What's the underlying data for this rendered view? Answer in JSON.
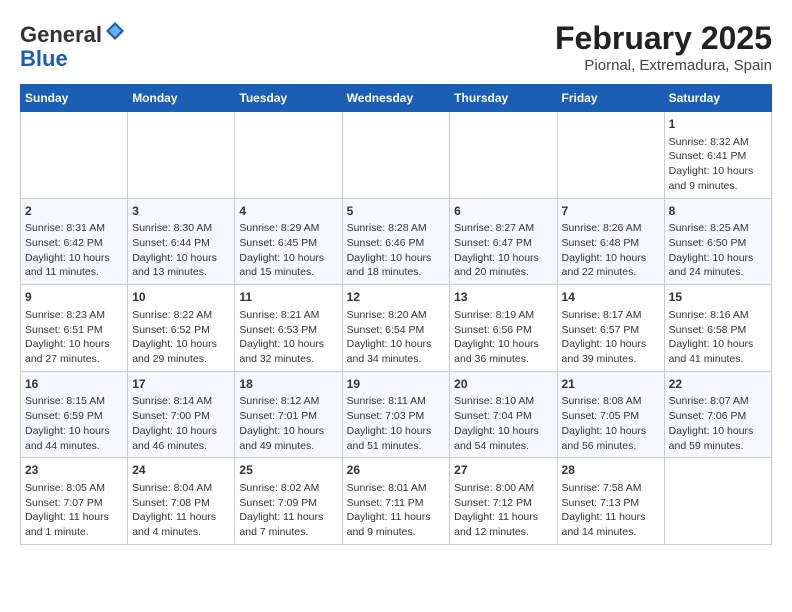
{
  "header": {
    "logo_general": "General",
    "logo_blue": "Blue",
    "month_title": "February 2025",
    "location": "Piornal, Extremadura, Spain"
  },
  "weekdays": [
    "Sunday",
    "Monday",
    "Tuesday",
    "Wednesday",
    "Thursday",
    "Friday",
    "Saturday"
  ],
  "weeks": [
    [
      {
        "day": "",
        "content": ""
      },
      {
        "day": "",
        "content": ""
      },
      {
        "day": "",
        "content": ""
      },
      {
        "day": "",
        "content": ""
      },
      {
        "day": "",
        "content": ""
      },
      {
        "day": "",
        "content": ""
      },
      {
        "day": "1",
        "content": "Sunrise: 8:32 AM\nSunset: 6:41 PM\nDaylight: 10 hours and 9 minutes."
      }
    ],
    [
      {
        "day": "2",
        "content": "Sunrise: 8:31 AM\nSunset: 6:42 PM\nDaylight: 10 hours and 11 minutes."
      },
      {
        "day": "3",
        "content": "Sunrise: 8:30 AM\nSunset: 6:44 PM\nDaylight: 10 hours and 13 minutes."
      },
      {
        "day": "4",
        "content": "Sunrise: 8:29 AM\nSunset: 6:45 PM\nDaylight: 10 hours and 15 minutes."
      },
      {
        "day": "5",
        "content": "Sunrise: 8:28 AM\nSunset: 6:46 PM\nDaylight: 10 hours and 18 minutes."
      },
      {
        "day": "6",
        "content": "Sunrise: 8:27 AM\nSunset: 6:47 PM\nDaylight: 10 hours and 20 minutes."
      },
      {
        "day": "7",
        "content": "Sunrise: 8:26 AM\nSunset: 6:48 PM\nDaylight: 10 hours and 22 minutes."
      },
      {
        "day": "8",
        "content": "Sunrise: 8:25 AM\nSunset: 6:50 PM\nDaylight: 10 hours and 24 minutes."
      }
    ],
    [
      {
        "day": "9",
        "content": "Sunrise: 8:23 AM\nSunset: 6:51 PM\nDaylight: 10 hours and 27 minutes."
      },
      {
        "day": "10",
        "content": "Sunrise: 8:22 AM\nSunset: 6:52 PM\nDaylight: 10 hours and 29 minutes."
      },
      {
        "day": "11",
        "content": "Sunrise: 8:21 AM\nSunset: 6:53 PM\nDaylight: 10 hours and 32 minutes."
      },
      {
        "day": "12",
        "content": "Sunrise: 8:20 AM\nSunset: 6:54 PM\nDaylight: 10 hours and 34 minutes."
      },
      {
        "day": "13",
        "content": "Sunrise: 8:19 AM\nSunset: 6:56 PM\nDaylight: 10 hours and 36 minutes."
      },
      {
        "day": "14",
        "content": "Sunrise: 8:17 AM\nSunset: 6:57 PM\nDaylight: 10 hours and 39 minutes."
      },
      {
        "day": "15",
        "content": "Sunrise: 8:16 AM\nSunset: 6:58 PM\nDaylight: 10 hours and 41 minutes."
      }
    ],
    [
      {
        "day": "16",
        "content": "Sunrise: 8:15 AM\nSunset: 6:59 PM\nDaylight: 10 hours and 44 minutes."
      },
      {
        "day": "17",
        "content": "Sunrise: 8:14 AM\nSunset: 7:00 PM\nDaylight: 10 hours and 46 minutes."
      },
      {
        "day": "18",
        "content": "Sunrise: 8:12 AM\nSunset: 7:01 PM\nDaylight: 10 hours and 49 minutes."
      },
      {
        "day": "19",
        "content": "Sunrise: 8:11 AM\nSunset: 7:03 PM\nDaylight: 10 hours and 51 minutes."
      },
      {
        "day": "20",
        "content": "Sunrise: 8:10 AM\nSunset: 7:04 PM\nDaylight: 10 hours and 54 minutes."
      },
      {
        "day": "21",
        "content": "Sunrise: 8:08 AM\nSunset: 7:05 PM\nDaylight: 10 hours and 56 minutes."
      },
      {
        "day": "22",
        "content": "Sunrise: 8:07 AM\nSunset: 7:06 PM\nDaylight: 10 hours and 59 minutes."
      }
    ],
    [
      {
        "day": "23",
        "content": "Sunrise: 8:05 AM\nSunset: 7:07 PM\nDaylight: 11 hours and 1 minute."
      },
      {
        "day": "24",
        "content": "Sunrise: 8:04 AM\nSunset: 7:08 PM\nDaylight: 11 hours and 4 minutes."
      },
      {
        "day": "25",
        "content": "Sunrise: 8:02 AM\nSunset: 7:09 PM\nDaylight: 11 hours and 7 minutes."
      },
      {
        "day": "26",
        "content": "Sunrise: 8:01 AM\nSunset: 7:11 PM\nDaylight: 11 hours and 9 minutes."
      },
      {
        "day": "27",
        "content": "Sunrise: 8:00 AM\nSunset: 7:12 PM\nDaylight: 11 hours and 12 minutes."
      },
      {
        "day": "28",
        "content": "Sunrise: 7:58 AM\nSunset: 7:13 PM\nDaylight: 11 hours and 14 minutes."
      },
      {
        "day": "",
        "content": ""
      }
    ]
  ]
}
